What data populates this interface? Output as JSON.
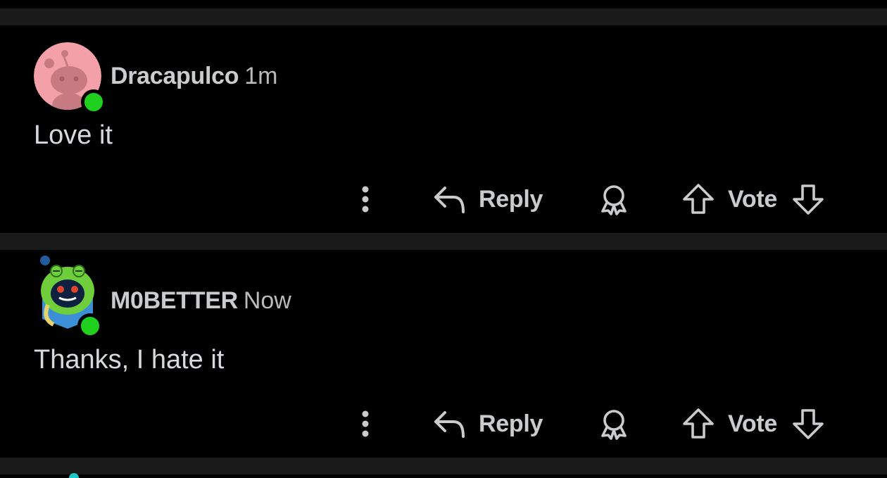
{
  "comments": [
    {
      "username": "Dracapulco",
      "timestamp": "1m",
      "body": "Love it",
      "avatar": "pink-snoo-avatar-icon",
      "online": true,
      "actions": {
        "more_icon": "kebab-menu-icon",
        "reply_label": "Reply",
        "award_icon": "award-icon",
        "vote_label": "Vote"
      }
    },
    {
      "username": "M0BETTER",
      "timestamp": "Now",
      "body": "Thanks, I hate it",
      "avatar": "green-frog-hood-snoo-avatar-icon",
      "online": true,
      "actions": {
        "more_icon": "kebab-menu-icon",
        "reply_label": "Reply",
        "award_icon": "award-icon",
        "vote_label": "Vote"
      }
    }
  ],
  "colors": {
    "background": "#000000",
    "divider": "#1a1a1b",
    "text": "#d7dadc",
    "muted": "#c9cbcd",
    "online": "#1fd01f"
  }
}
